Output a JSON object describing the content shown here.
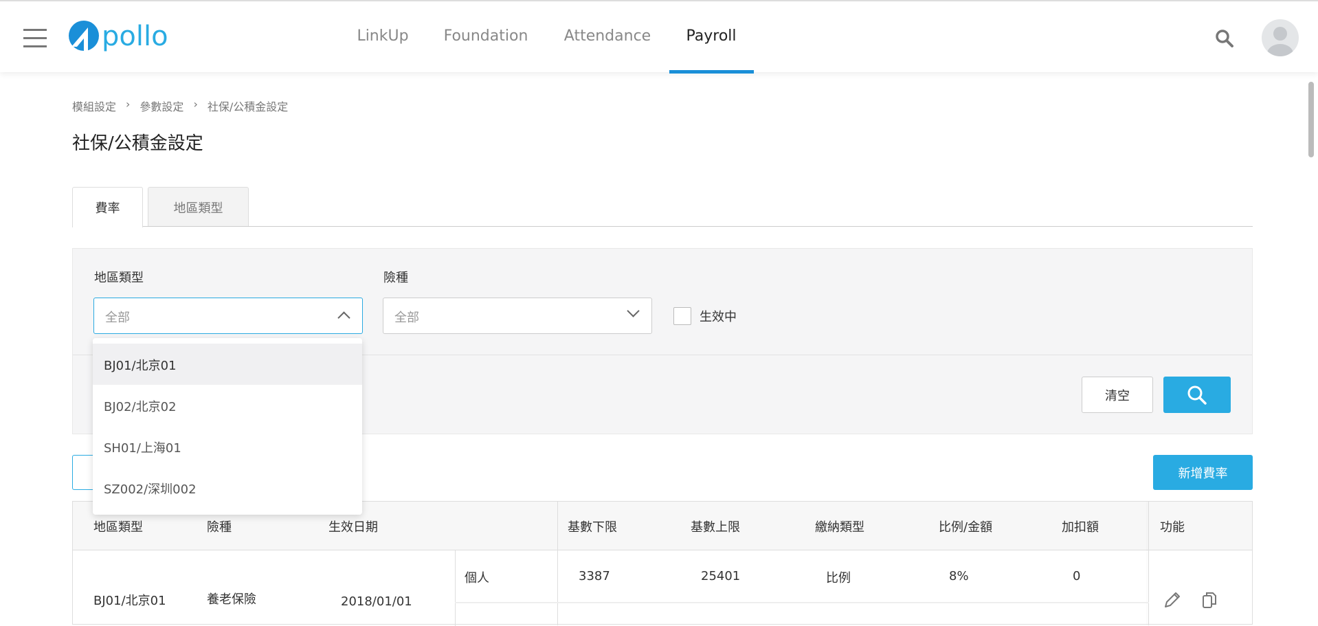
{
  "header": {
    "logo": "Apollo",
    "nav": [
      "LinkUp",
      "Foundation",
      "Attendance",
      "Payroll"
    ],
    "active_nav": "Payroll",
    "accent": "#1a8fd8"
  },
  "breadcrumb": [
    "模組設定",
    "參數設定",
    "社保/公積金設定"
  ],
  "page_title": "社保/公積金設定",
  "tabs": [
    "費率",
    "地區類型"
  ],
  "filter": {
    "region_label": "地區類型",
    "region_value": "全部",
    "insurance_label": "險種",
    "insurance_value": "全部",
    "active_label": "生效中",
    "active_checked": false,
    "clear_label": "清空",
    "search_icon": "search-icon"
  },
  "dropdown": {
    "options": [
      "BJ01/北京01",
      "BJ02/北京02",
      "SH01/上海01",
      "SZ002/深圳002"
    ],
    "highlighted": "BJ01/北京01"
  },
  "add_button": "新增費率",
  "table": {
    "headers": [
      "地區類型",
      "險種",
      "生效日期",
      "基數下限",
      "基數上限",
      "繳納類型",
      "比例/金額",
      "加扣額",
      "功能"
    ],
    "rows": [
      {
        "region": "BJ01/北京01",
        "insurance": "養老保險",
        "date": "2018/01/01",
        "party": "個人",
        "min": "3387",
        "max": "25401",
        "type": "比例",
        "rate": "8%",
        "adjust": "0"
      }
    ]
  },
  "colors": {
    "primary_button": "#29abe2"
  }
}
